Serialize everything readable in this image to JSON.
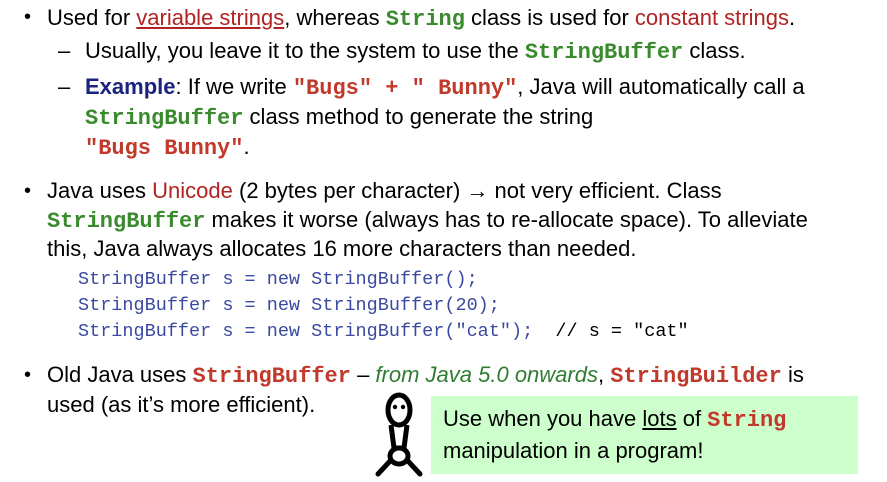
{
  "b1": {
    "t1": "Used for ",
    "link": "variable strings",
    "t2": ", whereas ",
    "code": "String",
    "t3": " class is used for ",
    "red": "constant strings",
    "t4": "."
  },
  "s1": {
    "t1": "Usually, you leave it to the system to use the ",
    "code": "StringBuffer",
    "t2": " class."
  },
  "s2": {
    "label": "Example",
    "t1": ": If we write ",
    "code1": "\"Bugs\" + \" Bunny\"",
    "t2": ", Java will automatically call a",
    "code2": "StringBuffer",
    "t3": " class method to generate the string",
    "code3": "\"Bugs Bunny\"",
    "t4": "."
  },
  "b2": {
    "t1": "Java uses ",
    "red": "Unicode",
    "t2": " (2 bytes per character) ",
    "arrow": "→",
    "t3": " not very efficient. Class",
    "code": "StringBuffer",
    "t4": " makes it worse (always has to re-allocate space). To alleviate",
    "t5": "this, Java always allocates 16 more characters than needed."
  },
  "code": {
    "l1": "StringBuffer s = new StringBuffer();",
    "l2": "StringBuffer s = new StringBuffer(20);",
    "l3": "StringBuffer s = new StringBuffer(\"cat\");",
    "c3": "// s = \"cat\""
  },
  "b3": {
    "t1": "Old Java uses ",
    "code1": "StringBuffer",
    "t2": " – ",
    "ital": "from Java 5.0 onwards",
    "t3": ", ",
    "code2": "StringBuilder",
    "t4": " is",
    "t5": "used (as it’s more efficient)."
  },
  "callout": {
    "t1": "Use when you have ",
    "u": "lots",
    "t2": " of ",
    "code": "String",
    "t3": "manipulation in a program!"
  }
}
